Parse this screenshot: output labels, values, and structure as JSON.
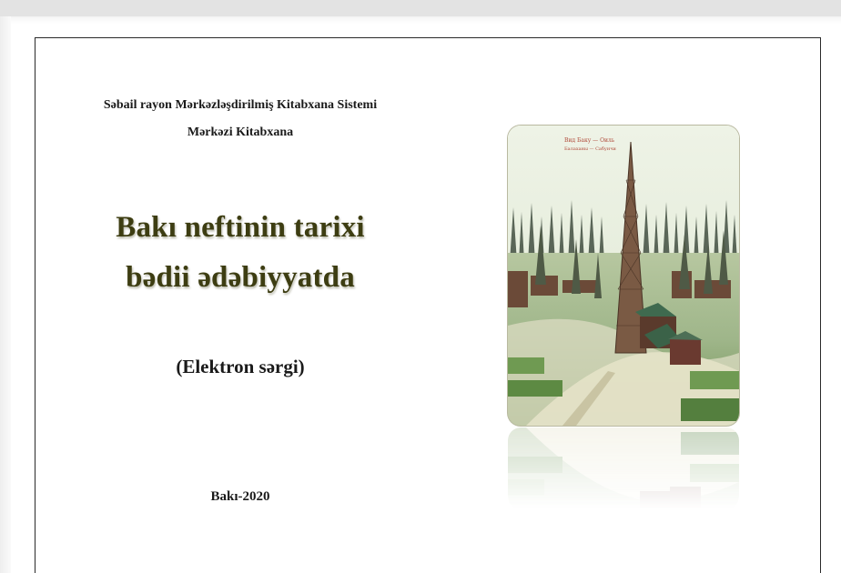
{
  "document": {
    "organization_line1": "Səbail rayon Mərkəzləşdirilmiş Kitabxana Sistemi",
    "organization_line2": "Mərkəzi Kitabxana",
    "title_line1": "Bakı neftinin tarixi",
    "title_line2": "bədii ədəbiyyatda",
    "subtitle": "(Elektron sərgi)",
    "place_year": "Bakı-2020"
  },
  "image": {
    "icon": "oil-derricks-postcard-illustration",
    "caption_line1": "Вид Баку — Оиль",
    "caption_line2": "Балаханы — Сабунчи"
  },
  "colors": {
    "title": "#3d3d12",
    "text": "#1a1a1a",
    "page_border": "#2a2a2a"
  }
}
